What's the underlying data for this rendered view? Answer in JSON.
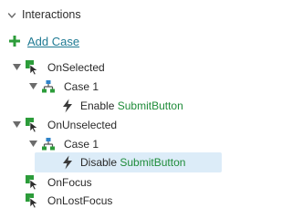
{
  "panel": {
    "title": "Interactions"
  },
  "add_case": {
    "label": "Add Case"
  },
  "tree": [
    {
      "id": "onselected",
      "kind": "event",
      "label": "OnSelected"
    },
    {
      "id": "onselected-case1",
      "kind": "case",
      "label": "Case 1"
    },
    {
      "id": "onselected-action",
      "kind": "action",
      "verb": "Enable",
      "target": "SubmitButton"
    },
    {
      "id": "onunselected",
      "kind": "event",
      "label": "OnUnselected"
    },
    {
      "id": "onunselected-case1",
      "kind": "case",
      "label": "Case 1"
    },
    {
      "id": "onunselected-action",
      "kind": "action",
      "verb": "Disable",
      "target": "SubmitButton",
      "selected": true
    },
    {
      "id": "onfocus",
      "kind": "event",
      "label": "OnFocus"
    },
    {
      "id": "onlostfocus",
      "kind": "event",
      "label": "OnLostFocus"
    }
  ],
  "colors": {
    "accent_green": "#1f8c3a",
    "link": "#1f7a93",
    "selection": "#dcecf8"
  }
}
